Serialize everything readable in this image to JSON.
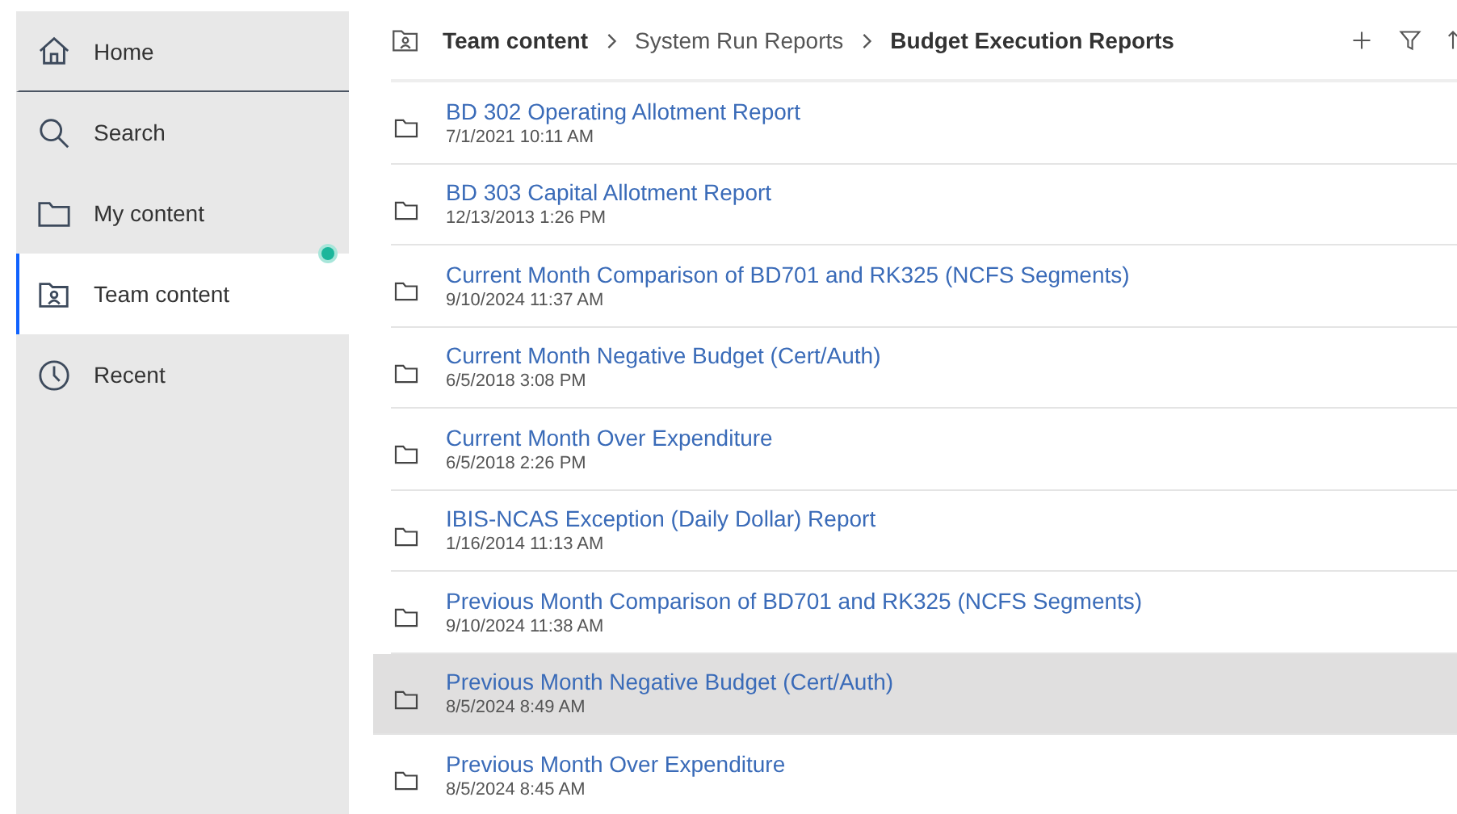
{
  "sidebar": {
    "items": [
      {
        "label": "Home",
        "kind": "home",
        "selected": false,
        "indicator": false
      },
      {
        "label": "Search",
        "kind": "search",
        "selected": false,
        "indicator": false
      },
      {
        "label": "My content",
        "kind": "folder",
        "selected": false,
        "indicator": true
      },
      {
        "label": "Team content",
        "kind": "team",
        "selected": true,
        "indicator": false
      },
      {
        "label": "Recent",
        "kind": "clock",
        "selected": false,
        "indicator": false
      }
    ]
  },
  "breadcrumb": [
    {
      "label": "Team content",
      "bold": true
    },
    {
      "label": "System Run Reports",
      "bold": false
    },
    {
      "label": "Budget Execution Reports",
      "bold": true
    }
  ],
  "toolbar": [
    {
      "kind": "add"
    },
    {
      "kind": "filter"
    },
    {
      "kind": "sort"
    }
  ],
  "rows": [
    {
      "name": "BD 302 Operating Allotment Report",
      "date": "7/1/2021 10:11 AM",
      "highlighted": false
    },
    {
      "name": "BD 303 Capital Allotment Report",
      "date": "12/13/2013 1:26 PM",
      "highlighted": false
    },
    {
      "name": "Current Month Comparison of BD701 and RK325 (NCFS Segments)",
      "date": "9/10/2024 11:37 AM",
      "highlighted": false
    },
    {
      "name": "Current Month Negative Budget (Cert/Auth)",
      "date": "6/5/2018 3:08 PM",
      "highlighted": false
    },
    {
      "name": "Current Month Over Expenditure",
      "date": "6/5/2018 2:26 PM",
      "highlighted": false
    },
    {
      "name": "IBIS-NCAS Exception (Daily Dollar) Report",
      "date": "1/16/2014 11:13 AM",
      "highlighted": false
    },
    {
      "name": "Previous Month Comparison of BD701 and RK325 (NCFS Segments)",
      "date": "9/10/2024 11:38 AM",
      "highlighted": false
    },
    {
      "name": "Previous Month Negative Budget (Cert/Auth)",
      "date": "8/5/2024 8:49 AM",
      "highlighted": true
    },
    {
      "name": "Previous Month Over Expenditure",
      "date": "8/5/2024 8:45 AM",
      "highlighted": false
    }
  ]
}
